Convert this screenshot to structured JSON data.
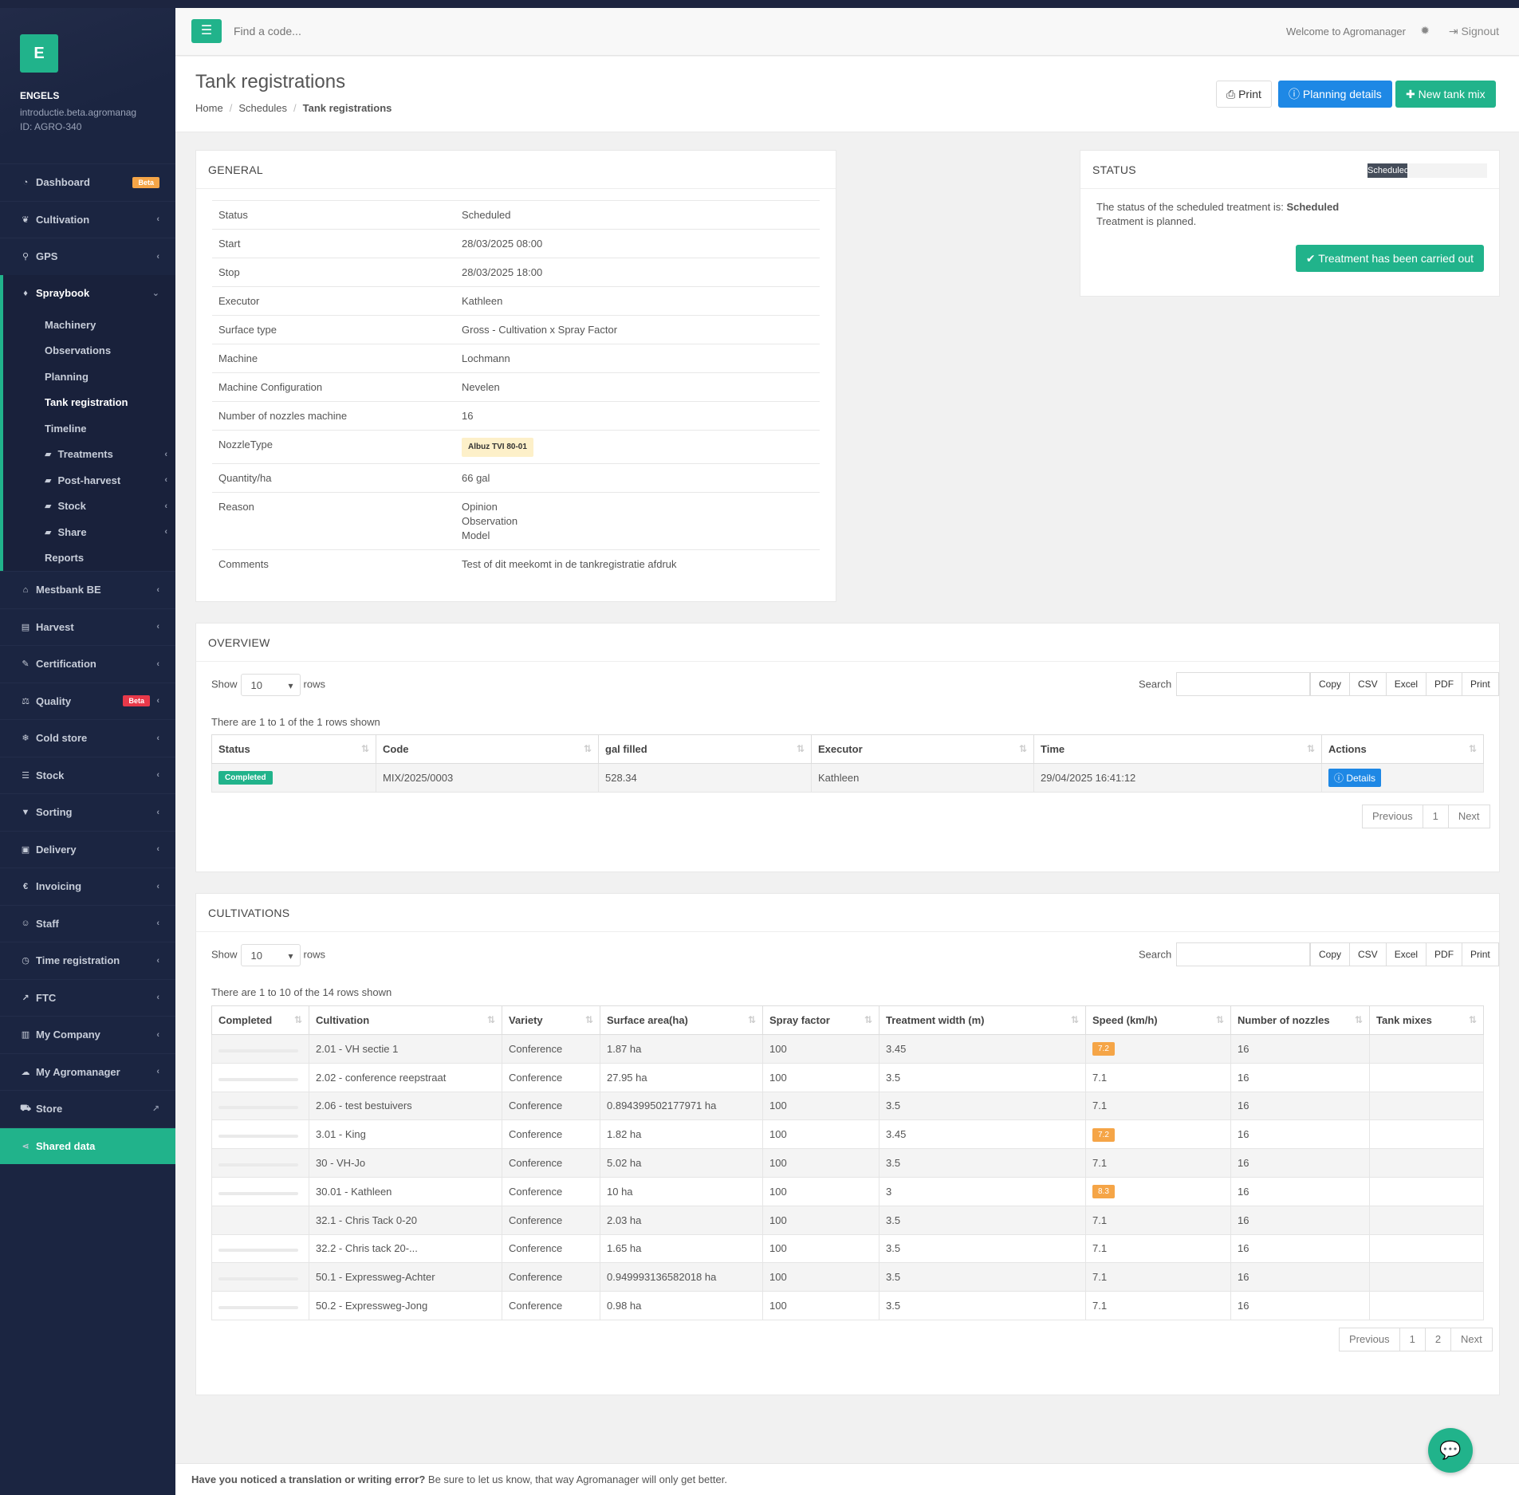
{
  "colors": {
    "accent": "#21b38b",
    "primary": "#1e88e5",
    "sidebar": "#1b2541",
    "warning": "#f5a547"
  },
  "sidebar": {
    "logo_letter": "E",
    "company_name": "ENGELS",
    "company_domain": "introductie.beta.agromanag",
    "company_id": "ID: AGRO-340",
    "items_top": [
      {
        "label": "Dashboard",
        "icon": "dashboard-icon",
        "glyph": "◔",
        "badge": "Beta"
      },
      {
        "label": "Cultivation",
        "icon": "leaf-icon",
        "glyph": "❦"
      },
      {
        "label": "GPS",
        "icon": "map-marker-icon",
        "glyph": "⚲"
      }
    ],
    "spraybook": {
      "label": "Spraybook",
      "icon": "drop-icon",
      "glyph": "♦",
      "children": [
        {
          "label": "Machinery"
        },
        {
          "label": "Observations"
        },
        {
          "label": "Planning"
        },
        {
          "label": "Tank registration",
          "active": true
        },
        {
          "label": "Timeline"
        },
        {
          "label": "Treatments",
          "icon": "folder-icon"
        },
        {
          "label": "Post-harvest",
          "icon": "folder-icon"
        },
        {
          "label": "Stock",
          "icon": "folder-icon"
        },
        {
          "label": "Share",
          "icon": "folder-icon"
        },
        {
          "label": "Reports"
        }
      ]
    },
    "items_bottom": [
      {
        "label": "Mestbank BE",
        "icon": "bank-icon",
        "glyph": "⌂"
      },
      {
        "label": "Harvest",
        "icon": "basket-icon",
        "glyph": "▤"
      },
      {
        "label": "Certification",
        "icon": "certificate-icon",
        "glyph": "✎"
      },
      {
        "label": "Quality",
        "icon": "balance-icon",
        "glyph": "⚖",
        "badge": "Beta"
      },
      {
        "label": "Cold store",
        "icon": "thermometer-icon",
        "glyph": "❄"
      },
      {
        "label": "Stock",
        "icon": "list-icon",
        "glyph": "☰"
      },
      {
        "label": "Sorting",
        "icon": "filter-icon",
        "glyph": "▼"
      },
      {
        "label": "Delivery",
        "icon": "truck-icon",
        "glyph": "▣"
      },
      {
        "label": "Invoicing",
        "icon": "euro-icon",
        "glyph": "€"
      },
      {
        "label": "Staff",
        "icon": "user-icon",
        "glyph": "☺"
      },
      {
        "label": "Time registration",
        "icon": "clock-icon",
        "glyph": "◷"
      },
      {
        "label": "FTC",
        "icon": "line-chart-icon",
        "glyph": "↗"
      },
      {
        "label": "My Company",
        "icon": "bar-chart-icon",
        "glyph": "▥"
      },
      {
        "label": "My Agromanager",
        "icon": "cloud-icon",
        "glyph": "☁"
      },
      {
        "label": "Store",
        "icon": "cart-icon",
        "glyph": "⛟"
      },
      {
        "label": "Shared data",
        "icon": "share-icon",
        "glyph": "⋖"
      }
    ]
  },
  "header": {
    "search_placeholder": "Find a code...",
    "welcome": "Welcome to Agromanager",
    "signout": "Signout"
  },
  "page": {
    "title": "Tank registrations",
    "breadcrumb": [
      "Home",
      "Schedules",
      "Tank registrations"
    ],
    "buttons": {
      "print": "Print",
      "planning": "Planning details",
      "new_mix": "New tank mix"
    }
  },
  "general": {
    "heading": "GENERAL",
    "rows": [
      {
        "k": "Status",
        "v": "Scheduled"
      },
      {
        "k": "Start",
        "v": "28/03/2025 08:00"
      },
      {
        "k": "Stop",
        "v": "28/03/2025 18:00"
      },
      {
        "k": "Executor",
        "v": "Kathleen"
      },
      {
        "k": "Surface type",
        "v": "Gross - Cultivation x Spray Factor"
      },
      {
        "k": "Machine",
        "v": "Lochmann"
      },
      {
        "k": "Machine Configuration",
        "v": "Nevelen"
      },
      {
        "k": "Number of nozzles machine",
        "v": "16"
      },
      {
        "k": "NozzleType",
        "v": "Albuz TVI 80-01",
        "tag": true
      },
      {
        "k": "Quantity/ha",
        "v": "66 gal"
      },
      {
        "k": "Reason",
        "lines": [
          "Opinion",
          "Observation",
          "Model"
        ]
      },
      {
        "k": "Comments",
        "v": "Test of dit meekomt in de tankregistratie afdruk"
      }
    ]
  },
  "status": {
    "heading": "STATUS",
    "progress_label": "Scheduled",
    "progress_fraction": 0.33,
    "line1_prefix": "The status of the scheduled treatment is: ",
    "line1_value": "Scheduled",
    "line2": "Treatment is planned.",
    "button": "Treatment has been carried out"
  },
  "overview": {
    "heading": "OVERVIEW",
    "show": "Show",
    "rows_word": "rows",
    "page_size": "10",
    "search": "Search",
    "export": [
      "Copy",
      "CSV",
      "Excel",
      "PDF",
      "Print"
    ],
    "info": "There are 1 to 1 of the 1 rows shown",
    "columns": [
      "Status",
      "Code",
      "gal filled",
      "Executor",
      "Time",
      "Actions"
    ],
    "rows": [
      {
        "status": "Completed",
        "code": "MIX/2025/0003",
        "gal": "528.34",
        "executor": "Kathleen",
        "time": "29/04/2025 16:41:12",
        "action": "Details"
      }
    ],
    "pager": [
      "Previous",
      "1",
      "Next"
    ]
  },
  "cultivations": {
    "heading": "CULTIVATIONS",
    "show": "Show",
    "rows_word": "rows",
    "page_size": "10",
    "search": "Search",
    "export": [
      "Copy",
      "CSV",
      "Excel",
      "PDF",
      "Print"
    ],
    "info": "There are 1 to 10 of the 14 rows shown",
    "columns": [
      "Completed",
      "Cultivation",
      "Variety",
      "Surface area(ha)",
      "Spray factor",
      "Treatment width (m)",
      "Speed (km/h)",
      "Number of nozzles",
      "Tank mixes"
    ],
    "rows": [
      {
        "cult": "2.01 - VH sectie 1",
        "var": "Conference",
        "area": "1.87 ha",
        "spray": "100",
        "width": "3.45",
        "speed": "7.2",
        "speed_badge": true,
        "nozz": "16"
      },
      {
        "cult": "2.02 - conference reepstraat",
        "var": "Conference",
        "area": "27.95 ha",
        "spray": "100",
        "width": "3.5",
        "speed": "7.1",
        "nozz": "16"
      },
      {
        "cult": "2.06 - test bestuivers",
        "var": "Conference",
        "area": "0.894399502177971 ha",
        "spray": "100",
        "width": "3.5",
        "speed": "7.1",
        "nozz": "16"
      },
      {
        "cult": "3.01 - King",
        "var": "Conference",
        "area": "1.82 ha",
        "spray": "100",
        "width": "3.45",
        "speed": "7.2",
        "speed_badge": true,
        "nozz": "16"
      },
      {
        "cult": "30 - VH-Jo",
        "var": "Conference",
        "area": "5.02 ha",
        "spray": "100",
        "width": "3.5",
        "speed": "7.1",
        "nozz": "16"
      },
      {
        "cult": "30.01 - Kathleen",
        "var": "Conference",
        "area": "10 ha",
        "spray": "100",
        "width": "3",
        "speed": "8.3",
        "speed_badge": true,
        "nozz": "16"
      },
      {
        "cult": "32.1 - Chris Tack 0-20",
        "var": "Conference",
        "area": "2.03 ha",
        "spray": "100",
        "width": "3.5",
        "speed": "7.1",
        "nozz": "16",
        "no_bar": true
      },
      {
        "cult": "32.2 - Chris tack 20-...",
        "var": "Conference",
        "area": "1.65 ha",
        "spray": "100",
        "width": "3.5",
        "speed": "7.1",
        "nozz": "16"
      },
      {
        "cult": "50.1 - Expressweg-Achter",
        "var": "Conference",
        "area": "0.949993136582018 ha",
        "spray": "100",
        "width": "3.5",
        "speed": "7.1",
        "nozz": "16"
      },
      {
        "cult": "50.2 - Expressweg-Jong",
        "var": "Conference",
        "area": "0.98 ha",
        "spray": "100",
        "width": "3.5",
        "speed": "7.1",
        "nozz": "16"
      }
    ],
    "pager": [
      "Previous",
      "1",
      "2",
      "Next"
    ]
  },
  "footer": {
    "bold": "Have you noticed a translation or writing error?",
    "text": " Be sure to let us know, that way Agromanager will only get better."
  }
}
